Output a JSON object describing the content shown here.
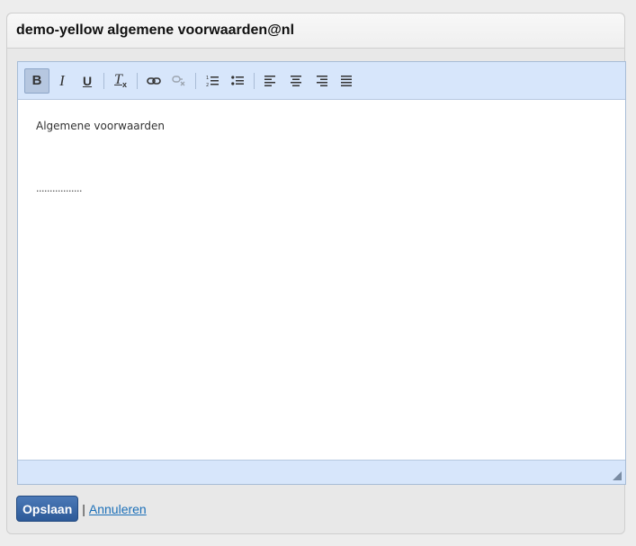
{
  "panel": {
    "title": "demo-yellow algemene voorwaarden@nl"
  },
  "toolbar": {
    "buttons": [
      {
        "name": "bold-icon",
        "glyph": "B",
        "state": "active"
      },
      {
        "name": "italic-icon",
        "glyph": "I"
      },
      {
        "name": "underline-icon",
        "glyph": "U"
      },
      {
        "name": "remove-format-icon",
        "glyph": "Tx"
      },
      {
        "name": "link-icon",
        "glyph": "link"
      },
      {
        "name": "unlink-icon",
        "glyph": "unlink",
        "state": "disabled"
      },
      {
        "name": "numbered-list-icon",
        "glyph": "ol"
      },
      {
        "name": "bulleted-list-icon",
        "glyph": "ul"
      },
      {
        "name": "align-left-icon",
        "glyph": "left"
      },
      {
        "name": "align-center-icon",
        "glyph": "center"
      },
      {
        "name": "align-right-icon",
        "glyph": "right"
      },
      {
        "name": "align-justify-icon",
        "glyph": "justify"
      }
    ]
  },
  "editor": {
    "line1": "Algemene voorwaarden",
    "line2": "................."
  },
  "actions": {
    "save_label": "Opslaan",
    "separator": "|",
    "cancel_label": "Annuleren"
  },
  "colors": {
    "toolbar_bg": "#d7e6fb",
    "save_button": "#3a67a6",
    "link": "#1b6fb8"
  }
}
